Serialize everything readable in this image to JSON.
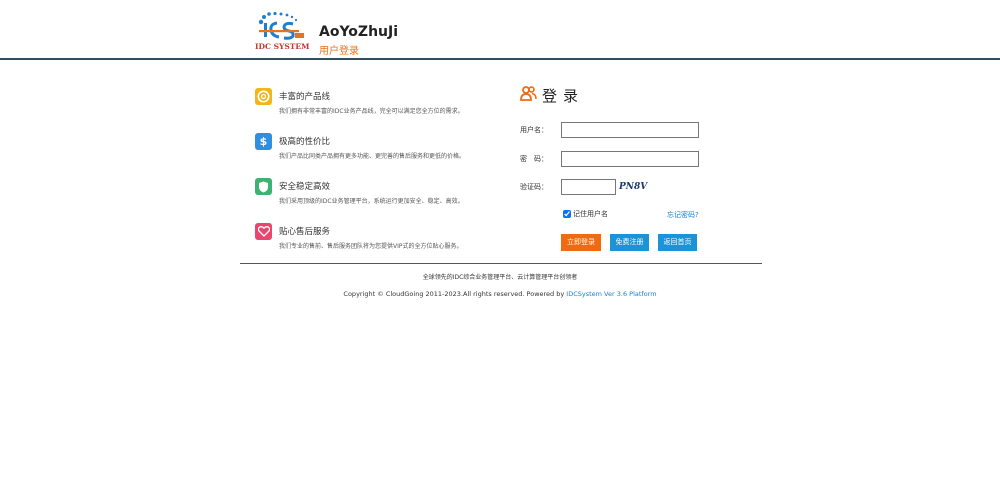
{
  "header": {
    "logo_text": "IDC SYSTEM",
    "brand": "AoYoZhuJi",
    "subtitle": "用户登录"
  },
  "features": [
    {
      "icon": "lifebuoy-icon",
      "color": "#f0b61a",
      "title": "丰富的产品线",
      "desc": "我们拥有非常丰富的IDC业务产品线，完全可以满足您全方位的需求。"
    },
    {
      "icon": "dollar-icon",
      "color": "#2f8fe0",
      "title": "极高的性价比",
      "desc": "我们产品比同类产品拥有更多功能、更完善的售后服务和更低的价格。"
    },
    {
      "icon": "shield-icon",
      "color": "#3cb371",
      "title": "安全稳定高效",
      "desc": "我们采用顶级的IDC业务管理平台，系统运行更加安全、稳定、高效。"
    },
    {
      "icon": "heart-icon",
      "color": "#e8466e",
      "title": "贴心售后服务",
      "desc": "我们专业的售前、售后服务团队将为您提供VIP式的全方位贴心服务。"
    }
  ],
  "login": {
    "title": "登录",
    "username_label": "用户名：",
    "username_value": "",
    "password_label": "密　码：",
    "password_value": "",
    "captcha_label": "验证码：",
    "captcha_value": "",
    "captcha_text": "PN8V",
    "remember_label": "记住用户名",
    "remember_checked": true,
    "forgot_label": "忘记密码?",
    "buttons": {
      "login": "立即登录",
      "register": "免费注册",
      "home": "返回首页"
    },
    "colors": {
      "login": "#f06a12",
      "register": "#1a93d9",
      "home": "#1a93d9"
    }
  },
  "footer": {
    "slogan": "全球领先的IDC综合业务管理平台、云计算管理平台创领者",
    "copyright": "Copyright © CloudGoing 2011-2023.All rights reserved. Powered by ",
    "powered_link": "IDCSystem Ver 3.6 Platform"
  }
}
